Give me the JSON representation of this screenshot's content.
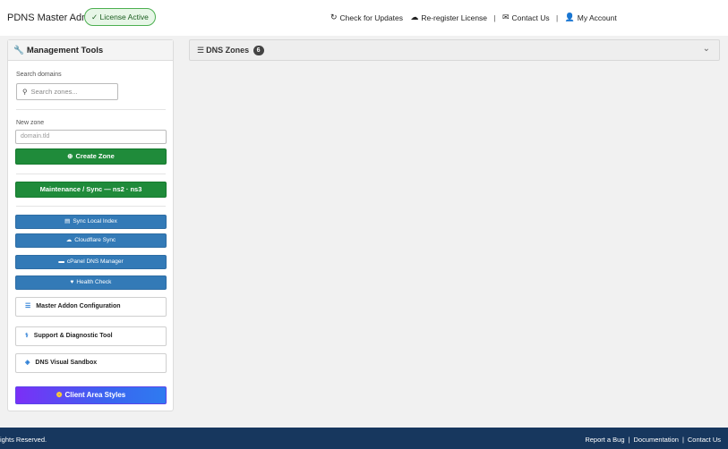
{
  "header": {
    "title": "PDNS Master Admin",
    "license_badge": "✓ License Active",
    "links": {
      "check_updates": "Check for Updates",
      "reregister": "Re-register License",
      "contact": "Contact Us",
      "account": "My Account",
      "separator": "|"
    }
  },
  "sidebar": {
    "title": "Management Tools",
    "search_label": "Search domains",
    "search_placeholder": "Search zones...",
    "new_zone_label": "New zone",
    "new_zone_placeholder": "domain.tld",
    "create_zone": "Create Zone",
    "maintenance": "Maintenance / Sync — ns2 · ns3",
    "sync_index": "Sync Local Index",
    "cloudflare": "Cloudflare Sync",
    "cpanel": "cPanel DNS Manager",
    "health": "Health Check",
    "addon_config": "Master Addon Configuration",
    "support_tool": "Support & Diagnostic Tool",
    "sandbox": "DNS Visual Sandbox",
    "client_styles": "Client Area Styles"
  },
  "zones": {
    "title": "DNS Zones",
    "count": "6"
  },
  "footer": {
    "left": "ights Reserved.",
    "report_bug": "Report a Bug",
    "documentation": "Documentation",
    "contact": "Contact Us",
    "separator": "|"
  },
  "colors": {
    "green": "#1f8b3a",
    "blue": "#337ab7",
    "footer": "#17375e",
    "gradient_start": "#7b2ff7",
    "gradient_end": "#2f7bf0"
  }
}
